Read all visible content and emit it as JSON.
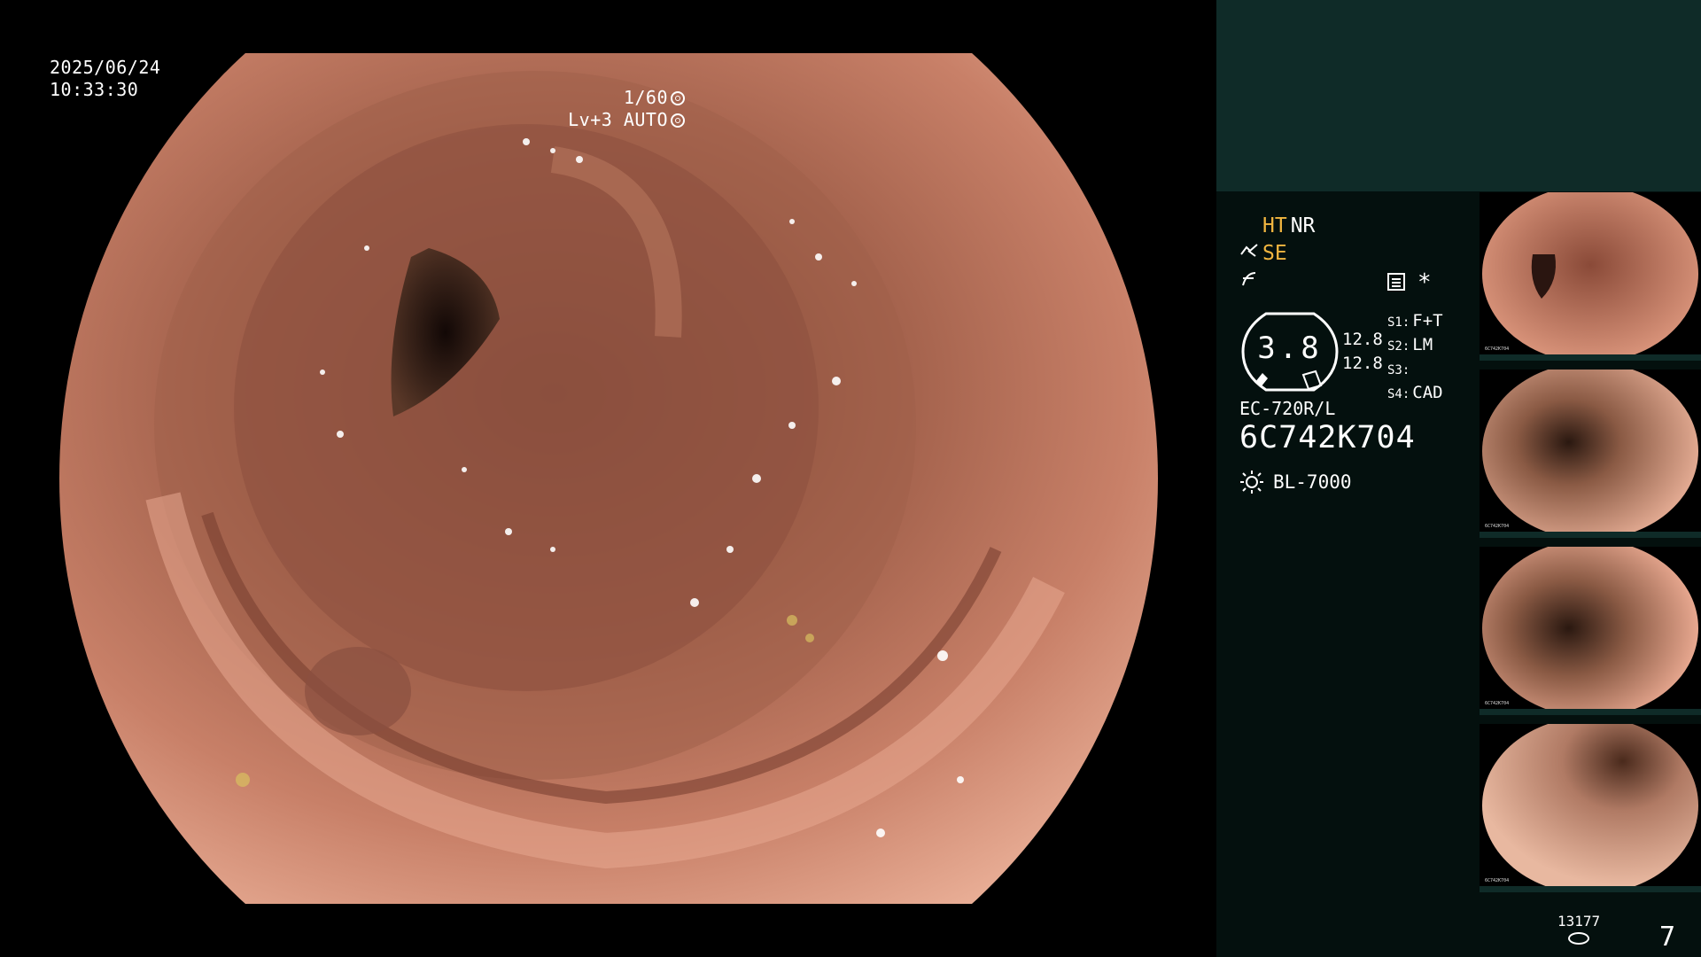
{
  "osd": {
    "date": "2025/06/24",
    "time": "10:33:30",
    "shutter": "1/60",
    "level": "Lv+3 AUTO"
  },
  "processor": {
    "mode_ht": "HT",
    "mode_nr": "NR",
    "mode_se": "SE",
    "gauge_value": "3.8",
    "gauge_values": [
      "12.8",
      "12.8"
    ],
    "switches": [
      {
        "key": "S1:",
        "value": "F+T"
      },
      {
        "key": "S2:",
        "value": "LM"
      },
      {
        "key": "S3:",
        "value": ""
      },
      {
        "key": "S4:",
        "value": "CAD"
      }
    ],
    "star": "*",
    "scope_model": "EC-720R/L",
    "serial": "6C742K704",
    "light_source": "BL-7000"
  },
  "thumbnails": {
    "label_model": "6C742K704",
    "count": 4
  },
  "footer": {
    "image_count": "13177",
    "page": "7"
  },
  "colors": {
    "panel_bg": "#04100e",
    "panel_top": "#0f2b28",
    "accent_yellow": "#f2b640"
  },
  "icons": [
    "shutter-icon",
    "auto-exposure-icon",
    "structure-enhance-icon",
    "freeze-icon",
    "document-icon",
    "light-source-icon",
    "storage-disk-icon"
  ]
}
